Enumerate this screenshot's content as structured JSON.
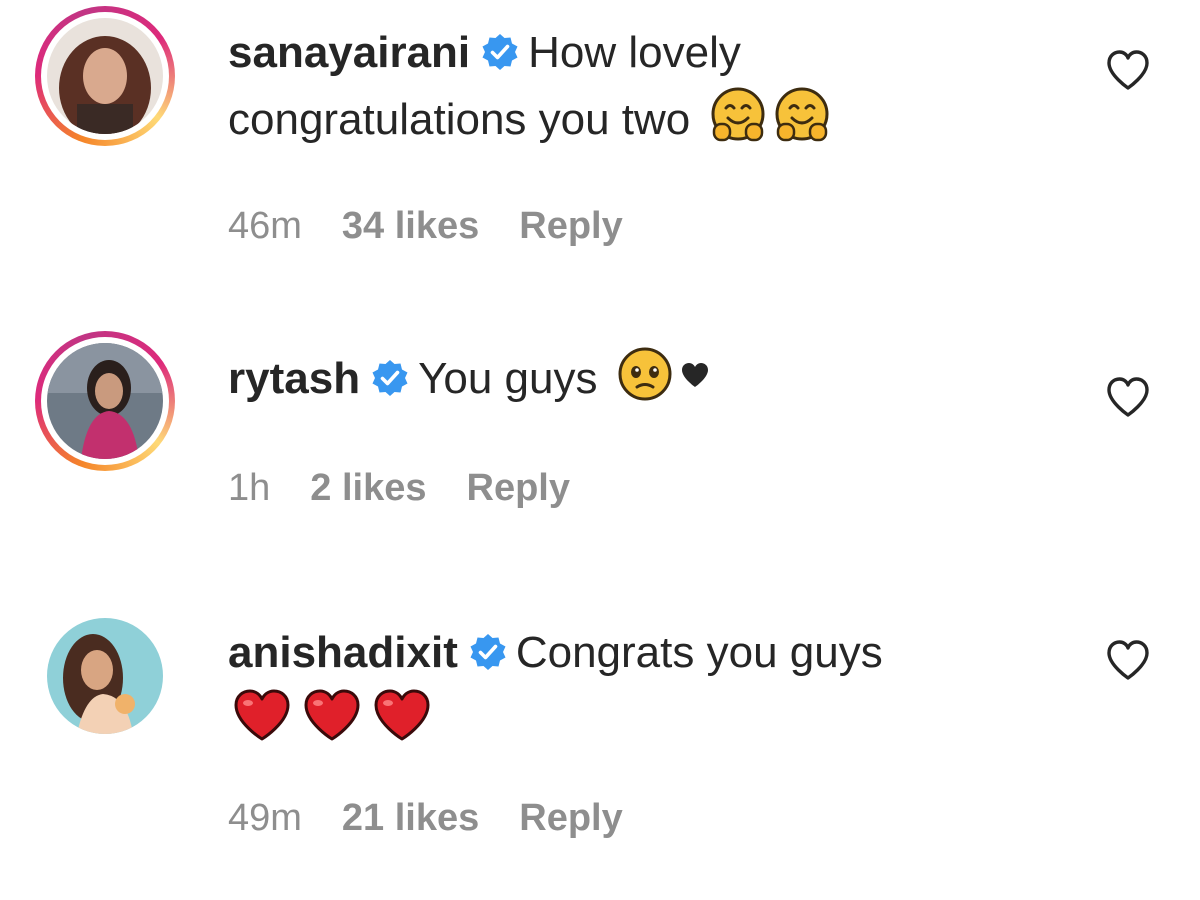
{
  "comments": [
    {
      "username": "sanayairani",
      "verified": true,
      "text_line1": "How lovely",
      "text_line2": "congratulations you two",
      "emojis": [
        "hugging-face-emoji",
        "hugging-face-emoji"
      ],
      "time": "46m",
      "likes": "34 likes",
      "reply_label": "Reply",
      "has_story_ring": true
    },
    {
      "username": "rytash",
      "verified": true,
      "text_line1": "You guys",
      "emojis": [
        "pleading-face-emoji",
        "black-heart-emoji"
      ],
      "time": "1h",
      "likes": "2 likes",
      "reply_label": "Reply",
      "has_story_ring": true
    },
    {
      "username": "anishadixit",
      "verified": true,
      "text_line1": "Congrats you guys",
      "emojis": [
        "red-heart-emoji",
        "red-heart-emoji",
        "red-heart-emoji"
      ],
      "time": "49m",
      "likes": "21 likes",
      "reply_label": "Reply",
      "has_story_ring": false
    }
  ],
  "colors": {
    "text": "#262626",
    "meta": "#8e8e8e",
    "verified_blue": "#3897f0",
    "heart_red": "#e0202a"
  }
}
